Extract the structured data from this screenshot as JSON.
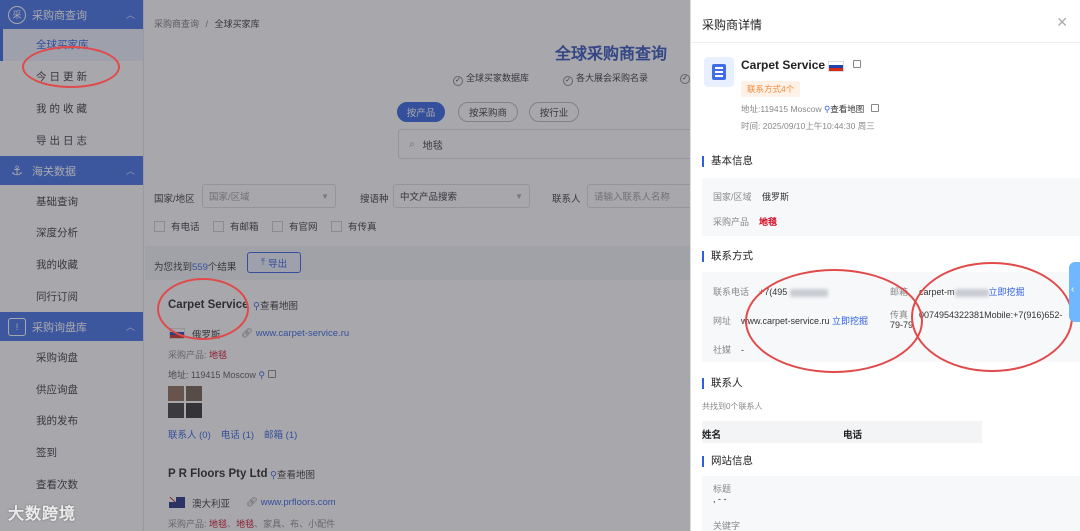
{
  "sidebar": {
    "groups": [
      {
        "title": "采购商查询",
        "icon": "buyer-icon",
        "items": [
          "全球买家库",
          "今日更新",
          "我的收藏",
          "导出日志"
        ]
      },
      {
        "title": "海关数据",
        "icon": "anchor-icon",
        "items": [
          "基础查询",
          "深度分析",
          "我的收藏",
          "同行订阅"
        ]
      },
      {
        "title": "采购询盘库",
        "icon": "inquiry-icon",
        "items": [
          "采购询盘",
          "供应询盘",
          "我的发布",
          "签到",
          "查看次数"
        ]
      }
    ]
  },
  "main": {
    "breadcrumb": {
      "parent": "采购商查询",
      "sep": "/",
      "current": "全球买家库"
    },
    "title": "全球采购商查询",
    "features": [
      "全球买家数据库",
      "各大展会采购名录"
    ],
    "tabs": [
      "按产品",
      "按采购商",
      "按行业"
    ],
    "search": {
      "value": "地毯"
    },
    "filters": {
      "region_label": "国家/地区",
      "region_placeholder": "国家/区域",
      "lang_label": "搜语种",
      "lang_value": "中文产品搜索",
      "contact_label": "联系人",
      "contact_placeholder": "请输入联系人名称"
    },
    "checkboxes": [
      "有电话",
      "有邮箱",
      "有官网",
      "有传真"
    ],
    "results": {
      "prefix": "为您找到",
      "count": "559",
      "suffix": "个结果",
      "export": "导出"
    },
    "cards": [
      {
        "name": "Carpet Service",
        "map": "查看地图",
        "country": "俄罗斯",
        "website": "www.carpet-service.ru",
        "product_label": "采购产品:",
        "products": "地毯",
        "address": "地址: 119415 Moscow",
        "stats": [
          "联系人 (0)",
          "电话 (1)",
          "邮箱 (1)"
        ]
      },
      {
        "name": "P R Floors Pty Ltd",
        "map": "查看地图",
        "country": "澳大利亚",
        "website": "www.prfloors.com",
        "product_label": "采购产品:",
        "products": [
          "地毯",
          "地毯",
          "家具",
          "布",
          "小配件"
        ]
      }
    ]
  },
  "drawer": {
    "title": "采购商详情",
    "company": "Carpet Service",
    "tag": "联系方式4个",
    "address": "地址:119415 Moscow",
    "map": "查看地图",
    "time": "时间: 2025/09/10上午10:44:30 周三",
    "basic_title": "基本信息",
    "basic": {
      "region_k": "国家/区域",
      "region_v": "俄罗斯",
      "product_k": "采购产品",
      "product_v": "地毯"
    },
    "contact_title": "联系方式",
    "contact": {
      "phone_k": "联系电话",
      "phone_v": "+7(495",
      "email_k": "邮箱",
      "email_v": "carpet-m",
      "mine": "立即挖掘",
      "web_k": "网址",
      "web_v": "www.carpet-service.ru",
      "web_mine": "立即挖掘",
      "fax_k": "传真",
      "fax_v": "0074954322381Mobile:+7(916)652-",
      "fax_v2": "79-79",
      "social_k": "社媒",
      "social_v": "-"
    },
    "people_title": "联系人",
    "people_note": "共找到0个联系人",
    "people_cols": [
      "姓名",
      "电话"
    ],
    "site_title": "网站信息",
    "site_label_title": "标题",
    "site_title_v": ", - -",
    "site_label_kw": "关键字"
  },
  "watermark": "大数跨境"
}
